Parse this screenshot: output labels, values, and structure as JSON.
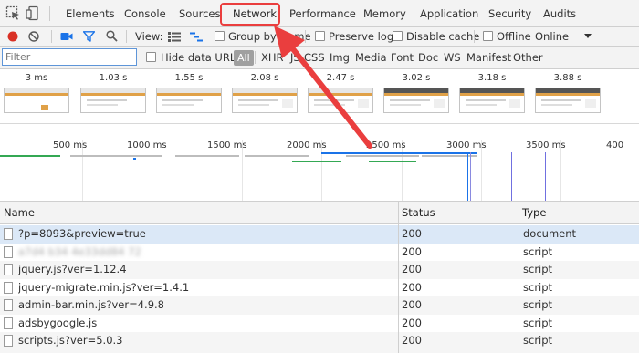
{
  "devtools": {
    "tabs": [
      {
        "label": "Elements"
      },
      {
        "label": "Console"
      },
      {
        "label": "Sources"
      },
      {
        "label": "Network"
      },
      {
        "label": "Performance"
      },
      {
        "label": "Memory"
      },
      {
        "label": "Application"
      },
      {
        "label": "Security"
      },
      {
        "label": "Audits"
      }
    ],
    "selected_tab": "Network"
  },
  "toolbar": {
    "view_label": "View:",
    "group_by_frame": "Group by frame",
    "preserve_log": "Preserve log",
    "disable_cache": "Disable cache",
    "offline": "Offline",
    "throttle_value": "Online"
  },
  "filter": {
    "placeholder": "Filter",
    "hide_data_urls": "Hide data URLs",
    "types": [
      "All",
      "XHR",
      "JS",
      "CSS",
      "Img",
      "Media",
      "Font",
      "Doc",
      "WS",
      "Manifest",
      "Other"
    ],
    "active_type": "All"
  },
  "filmstrip": {
    "frames": [
      "3 ms",
      "1.03 s",
      "1.55 s",
      "2.08 s",
      "2.47 s",
      "3.02 s",
      "3.18 s",
      "3.88 s"
    ]
  },
  "overview": {
    "ticks": [
      "500 ms",
      "1000 ms",
      "1500 ms",
      "2000 ms",
      "2500 ms",
      "3000 ms",
      "3500 ms",
      "400"
    ]
  },
  "table": {
    "columns": [
      "Name",
      "Status",
      "Type"
    ],
    "rows": [
      {
        "name": "?p=8093&preview=true",
        "status": "200",
        "type": "document"
      },
      {
        "name": "a7d4 b34 4e33dd84 72",
        "status": "200",
        "type": "script"
      },
      {
        "name": "jquery.js?ver=1.12.4",
        "status": "200",
        "type": "script"
      },
      {
        "name": "jquery-migrate.min.js?ver=1.4.1",
        "status": "200",
        "type": "script"
      },
      {
        "name": "admin-bar.min.js?ver=4.9.8",
        "status": "200",
        "type": "script"
      },
      {
        "name": "adsbygoogle.js",
        "status": "200",
        "type": "script"
      },
      {
        "name": "scripts.js?ver=5.0.3",
        "status": "200",
        "type": "script"
      }
    ]
  },
  "colors": {
    "record": "#d93025",
    "accent": "#1a73e8",
    "annotation": "#ea3e3e",
    "selected_row": "#dbe8f7"
  }
}
